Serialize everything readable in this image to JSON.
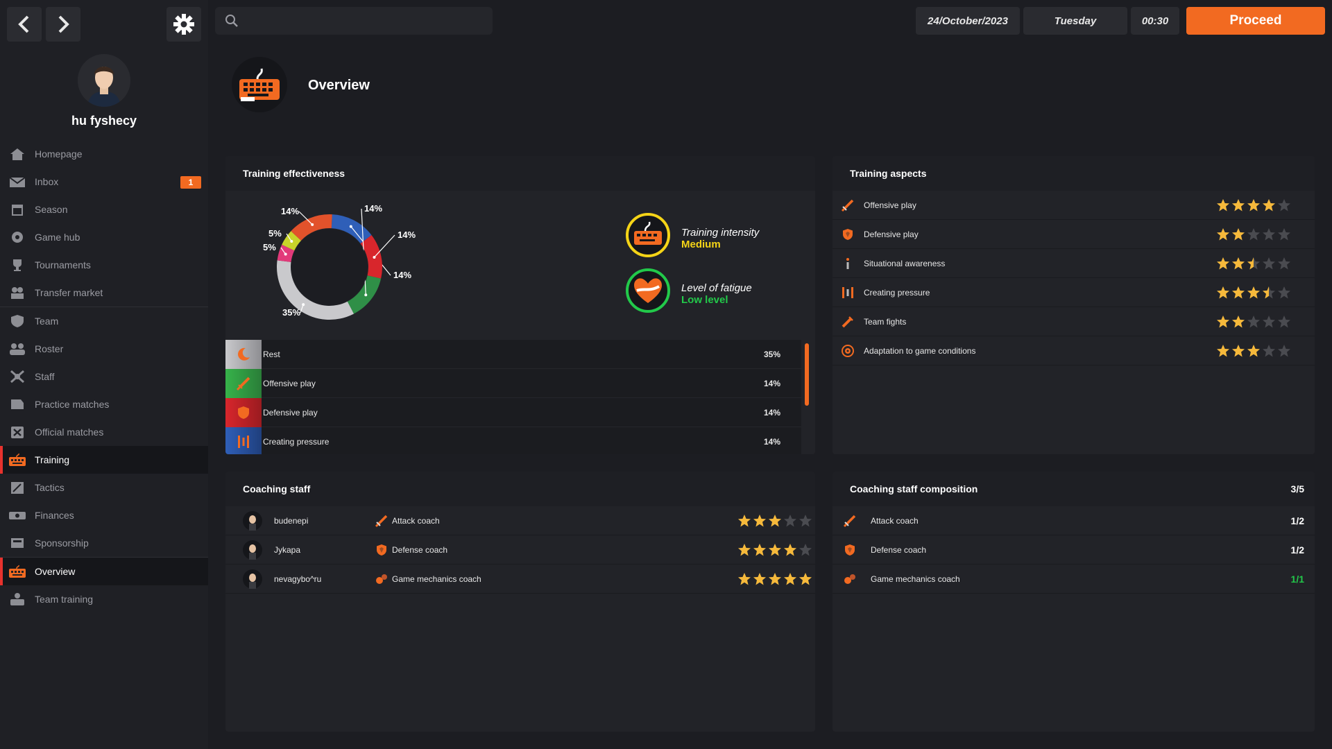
{
  "nav_buttons": {
    "back": "back-arrow",
    "forward": "forward-arrow",
    "settings": "gear"
  },
  "search": {
    "placeholder": "",
    "value": ""
  },
  "date": "24/October/2023",
  "weekday": "Tuesday",
  "time": "00:30",
  "proceed_label": "Proceed",
  "user": {
    "name": "hu fyshecy"
  },
  "sidebar": {
    "items": [
      {
        "label": "Homepage",
        "icon": "home-icon"
      },
      {
        "label": "Inbox",
        "icon": "mail-icon",
        "badge": "1"
      },
      {
        "label": "Season",
        "icon": "calendar-icon"
      },
      {
        "label": "Game hub",
        "icon": "gamepad-icon"
      },
      {
        "label": "Tournaments",
        "icon": "trophy-icon"
      },
      {
        "label": "Transfer market",
        "icon": "transfer-icon"
      },
      {
        "label": "Team",
        "icon": "shield-icon"
      },
      {
        "label": "Roster",
        "icon": "people-icon"
      },
      {
        "label": "Staff",
        "icon": "staff-icon"
      },
      {
        "label": "Practice matches",
        "icon": "practice-icon"
      },
      {
        "label": "Official matches",
        "icon": "swords-icon"
      },
      {
        "label": "Training",
        "icon": "keyboard-icon",
        "active": true
      },
      {
        "label": "Tactics",
        "icon": "tactics-icon"
      },
      {
        "label": "Finances",
        "icon": "money-icon"
      },
      {
        "label": "Sponsorship",
        "icon": "sponsor-icon"
      },
      {
        "label": "Overview",
        "icon": "keyboard-icon",
        "active": true
      },
      {
        "label": "Team training",
        "icon": "team-training-icon"
      }
    ]
  },
  "page": {
    "title": "Overview"
  },
  "training_effectiveness": {
    "title": "Training effectiveness",
    "donut_labels": [
      "14%",
      "14%",
      "14%",
      "14%",
      "35%",
      "5%",
      "5%"
    ],
    "intensity": {
      "label": "Training intensity",
      "value": "Medium",
      "color": "#f5d417"
    },
    "fatigue": {
      "label": "Level of fatigue",
      "value": "Low level",
      "color": "#22c94a"
    },
    "allocation": [
      {
        "label": "Rest",
        "pct": "35%",
        "color": "#c9c9cc",
        "icon": "moon-icon"
      },
      {
        "label": "Offensive play",
        "pct": "14%",
        "color": "#36b34a",
        "icon": "sword-icon"
      },
      {
        "label": "Defensive play",
        "pct": "14%",
        "color": "#d8262c",
        "icon": "shield-icon"
      },
      {
        "label": "Creating pressure",
        "pct": "14%",
        "color": "#2f5fb8",
        "icon": "pressure-icon"
      }
    ]
  },
  "chart_data": {
    "type": "pie",
    "categories": [
      "Offensive play",
      "Defensive play",
      "Creating pressure",
      "Team fights",
      "Rest",
      "Situational awareness",
      "Adaptation to game conditions"
    ],
    "values": [
      14,
      14,
      14,
      14,
      35,
      5,
      5
    ],
    "colors": [
      "#2f8f47",
      "#d8262c",
      "#2f5fb8",
      "#e2522b",
      "#c9c9cc",
      "#c8d42a",
      "#e23a7a"
    ]
  },
  "training_aspects": {
    "title": "Training aspects",
    "items": [
      {
        "label": "Offensive play",
        "rating": 4,
        "icon": "sword-icon"
      },
      {
        "label": "Defensive play",
        "rating": 2,
        "icon": "shield-icon"
      },
      {
        "label": "Situational awareness",
        "rating": 2.5,
        "icon": "info-icon"
      },
      {
        "label": "Creating pressure",
        "rating": 3.5,
        "icon": "pressure-icon"
      },
      {
        "label": "Team fights",
        "rating": 2,
        "icon": "fight-icon"
      },
      {
        "label": "Adaptation to game conditions",
        "rating": 3,
        "icon": "target-icon"
      }
    ]
  },
  "coaching_staff": {
    "title": "Coaching staff",
    "rows": [
      {
        "name": "budenepi",
        "role": "Attack coach",
        "rating": 3,
        "role_icon": "sword-icon"
      },
      {
        "name": "Jykapa",
        "role": "Defense coach",
        "rating": 4,
        "role_icon": "shield-icon"
      },
      {
        "name": "nevagybo^ru",
        "role": "Game mechanics coach",
        "rating": 5,
        "role_icon": "mechanics-icon"
      }
    ]
  },
  "staff_composition": {
    "title": "Coaching staff composition",
    "total": "3/5",
    "rows": [
      {
        "role": "Attack coach",
        "count": "1/2",
        "color": "#ffffff",
        "icon": "sword-icon"
      },
      {
        "role": "Defense coach",
        "count": "1/2",
        "color": "#ffffff",
        "icon": "shield-icon"
      },
      {
        "role": "Game mechanics coach",
        "count": "1/1",
        "color": "#22c94a",
        "icon": "mechanics-icon"
      }
    ]
  },
  "colors": {
    "accent": "#f26a21",
    "star": "#f6b93b",
    "star_empty": "#4a4b50",
    "active_marker": "#e8322d"
  }
}
